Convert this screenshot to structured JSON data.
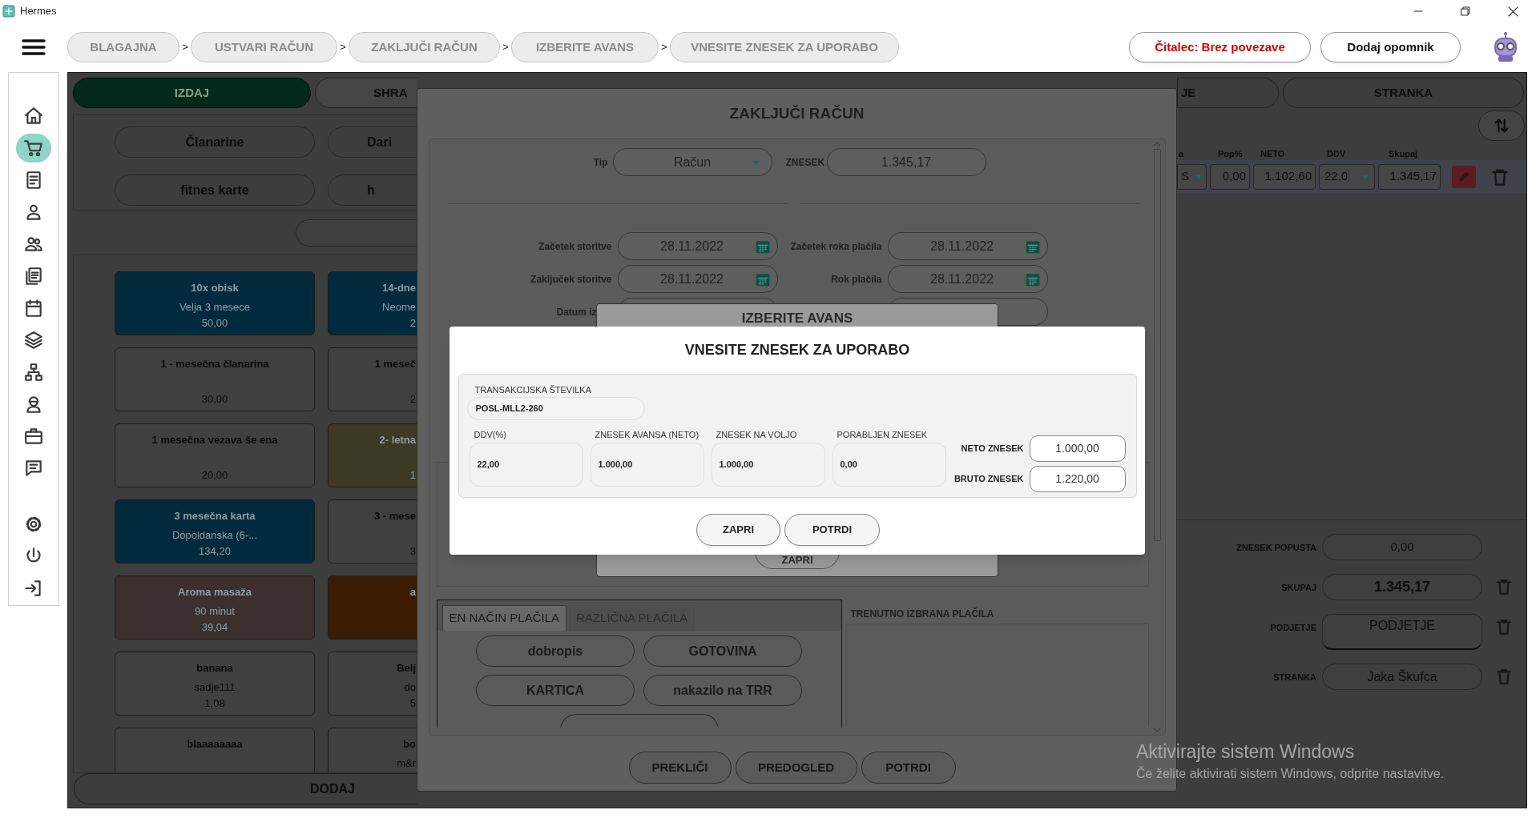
{
  "window": {
    "title": "Hermes"
  },
  "breadcrumbs": [
    {
      "label": "BLAGAJNA",
      "separator": ">"
    },
    {
      "label": "USTVARI RAČUN",
      "separator": ">"
    },
    {
      "label": "ZAKLJUČI RAČUN",
      "separator": ">"
    },
    {
      "label": "IZBERITE AVANS",
      "separator": ">"
    },
    {
      "label": "VNESITE ZNESEK ZA UPORABO"
    }
  ],
  "reader_status": "Čitalec: Brez povezave",
  "reminder_button": "Dodaj opomnik",
  "sidebar": {
    "top": [
      {
        "selected": false
      },
      {
        "selected": true
      },
      {
        "selected": false
      },
      {
        "selected": false
      },
      {
        "selected": false
      },
      {
        "selected": false
      },
      {
        "selected": false
      },
      {
        "selected": false
      },
      {
        "selected": false
      },
      {
        "selected": false
      },
      {
        "selected": false
      },
      {
        "selected": false
      }
    ],
    "bottom": [
      {
        "selected": false
      },
      {
        "selected": false
      },
      {
        "selected": false
      }
    ]
  },
  "left_panel": {
    "actions": [
      {
        "label": "IZDAJ",
        "kind": "primary"
      },
      {
        "label": "SHRA",
        "kind": "plain"
      }
    ],
    "categories": [
      "Članarine",
      "Dari",
      "fitnes karte",
      "h"
    ],
    "products": [
      {
        "title": "10x obisk",
        "subtitle": "Velja 3 mesece",
        "price": "50,00",
        "color": "#022a3d"
      },
      {
        "title": "14-dne",
        "subtitle": "Neome",
        "price": "2",
        "color": "#022a3d"
      },
      {
        "title": "1 - mesečna članarina",
        "price": "30,00",
        "color": "#404040"
      },
      {
        "title": "1 meseč",
        "price": "2",
        "color": "#404040"
      },
      {
        "title": "1 mesečna vezava še ena",
        "price": "20,00",
        "color": "#404040"
      },
      {
        "title": "2- letna",
        "price": "1",
        "color": "#3c3a25"
      },
      {
        "title": "3 mesečna karta",
        "subtitle": "Dopoldanska (6-...",
        "price": "134,20",
        "color": "#022a3d"
      },
      {
        "title": "3 - mese",
        "price": "3",
        "color": "#404040"
      },
      {
        "title": "Aroma masaža",
        "subtitle": "90 minut",
        "price": "39,04",
        "color": "#3b2f30"
      },
      {
        "title": "a",
        "color": "#3a1c02"
      },
      {
        "title": "banana",
        "subtitle": "sadje111",
        "price": "1,08",
        "color": "#404040"
      },
      {
        "title": "Belj",
        "subtitle": "do",
        "price": "5",
        "color": "#404040"
      },
      {
        "title": "blaaaaaaaa",
        "color": "#404040"
      },
      {
        "title": "bo",
        "subtitle": "m&r",
        "color": "#404040"
      }
    ],
    "add_button": "DODAJ"
  },
  "right_panel": {
    "tabs": [
      "JE",
      "STRANKA"
    ],
    "columns": [
      "a",
      "Pop%",
      "NETO",
      "DDV",
      "Skupaj"
    ],
    "row": {
      "unit": "S",
      "discount": "0,00",
      "net": "1.102,60",
      "vat": "22,0",
      "total": "1.345,17"
    },
    "totals": [
      {
        "label": "ZNESEK POPUSTA",
        "value": "0,00",
        "kind": "plain"
      },
      {
        "label": "SKUPAJ",
        "value": "1.345,17",
        "kind": "total"
      },
      {
        "label": "PODJETJE",
        "value": "PODJETJE",
        "kind": "button"
      },
      {
        "label": "STRANKA",
        "value": "Jaka Škufca",
        "kind": "field"
      }
    ]
  },
  "close_invoice": {
    "title": "ZAKLJUČI RAČUN",
    "type_label": "Tip",
    "type_value": "Račun",
    "amount_label": "ZNESEK",
    "amount_value": "1.345,17",
    "dates": [
      {
        "label": "Začetek storitve",
        "value": "28.11.2022"
      },
      {
        "label": "Začetek roka plačila",
        "value": "28.11.2022"
      },
      {
        "label": "Zaključek storitve",
        "value": "28.11.2022"
      },
      {
        "label": "Rok plačila",
        "value": "28.11.2022"
      }
    ],
    "issue_date_label": "Datum iz",
    "payment_tabs": [
      {
        "label": "EN NAČIN PLAČILA",
        "selected": true
      },
      {
        "label": "RAZLIČNA PLAČILA",
        "selected": false
      }
    ],
    "payment_methods": [
      "dobropis",
      "GOTOVINA",
      "KARTICA",
      "nakazilo na TRR"
    ],
    "selected_payments_label": "TRENUTNO IZBRANA PLAČILA",
    "buttons": [
      "PREKLIČI",
      "PREDOGLED",
      "POTRDI"
    ]
  },
  "choose_advance": {
    "title": "IZBERITE AVANS",
    "close_button": "ZAPRI"
  },
  "enter_amount": {
    "title": "VNESITE ZNESEK ZA UPORABO",
    "transaction_label": "TRANSAKCIJSKA ŠTEVILKA",
    "transaction_number": "POSL-MLL2-260",
    "fields": [
      {
        "label": "DDV(%)",
        "value": "22,00"
      },
      {
        "label": "ZNESEK AVANSA (NETO)",
        "value": "1.000,00"
      },
      {
        "label": "ZNESEK NA VOLJO",
        "value": "1.000,00"
      },
      {
        "label": "PORABLJEN ZNESEK",
        "value": "0,00"
      }
    ],
    "net_label": "NETO ZNESEK",
    "net_value": "1.000,00",
    "gross_label": "BRUTO ZNESEK",
    "gross_value": "1.220,00",
    "buttons": [
      "ZAPRI",
      "POTRDI"
    ]
  },
  "os_notice": {
    "title": "Aktivirajte sistem Windows",
    "text": "Če želite aktivirati sistem Windows, odprite nastavitve."
  }
}
